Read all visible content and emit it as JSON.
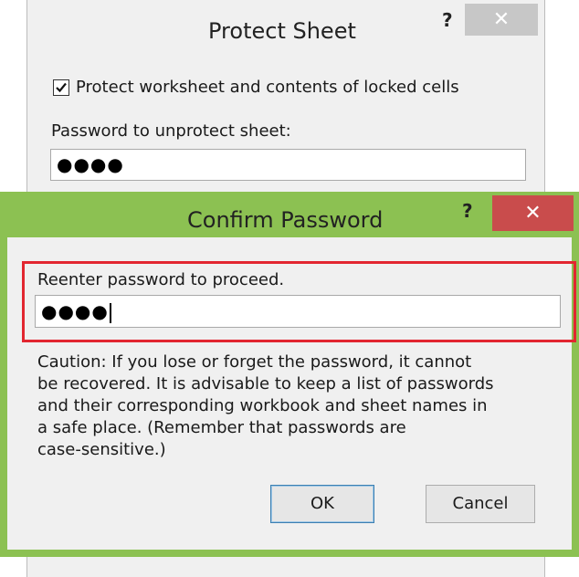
{
  "protect_sheet": {
    "title": "Protect Sheet",
    "help": "?",
    "close": "✕",
    "protect_checkbox": {
      "label": "Protect worksheet and contents of locked cells",
      "checked": true
    },
    "password_label": "Password to unprotect sheet:",
    "password_value": "●●●●"
  },
  "confirm_password": {
    "title": "Confirm Password",
    "help": "?",
    "close": "✕",
    "reenter_label": "Reenter password to proceed.",
    "reenter_value": "●●●●",
    "caution": "Caution: If you lose or forget the password, it cannot\nbe recovered. It is advisable to keep a list of passwords\nand their corresponding workbook and sheet names in\na safe place.  (Remember that passwords are\ncase-sensitive.)",
    "ok_label": "OK",
    "cancel_label": "Cancel"
  },
  "colors": {
    "dialog_border_active": "#8cc152",
    "close_active": "#c94c4c",
    "close_inactive": "#c7c7c7",
    "highlight": "#e22630"
  }
}
